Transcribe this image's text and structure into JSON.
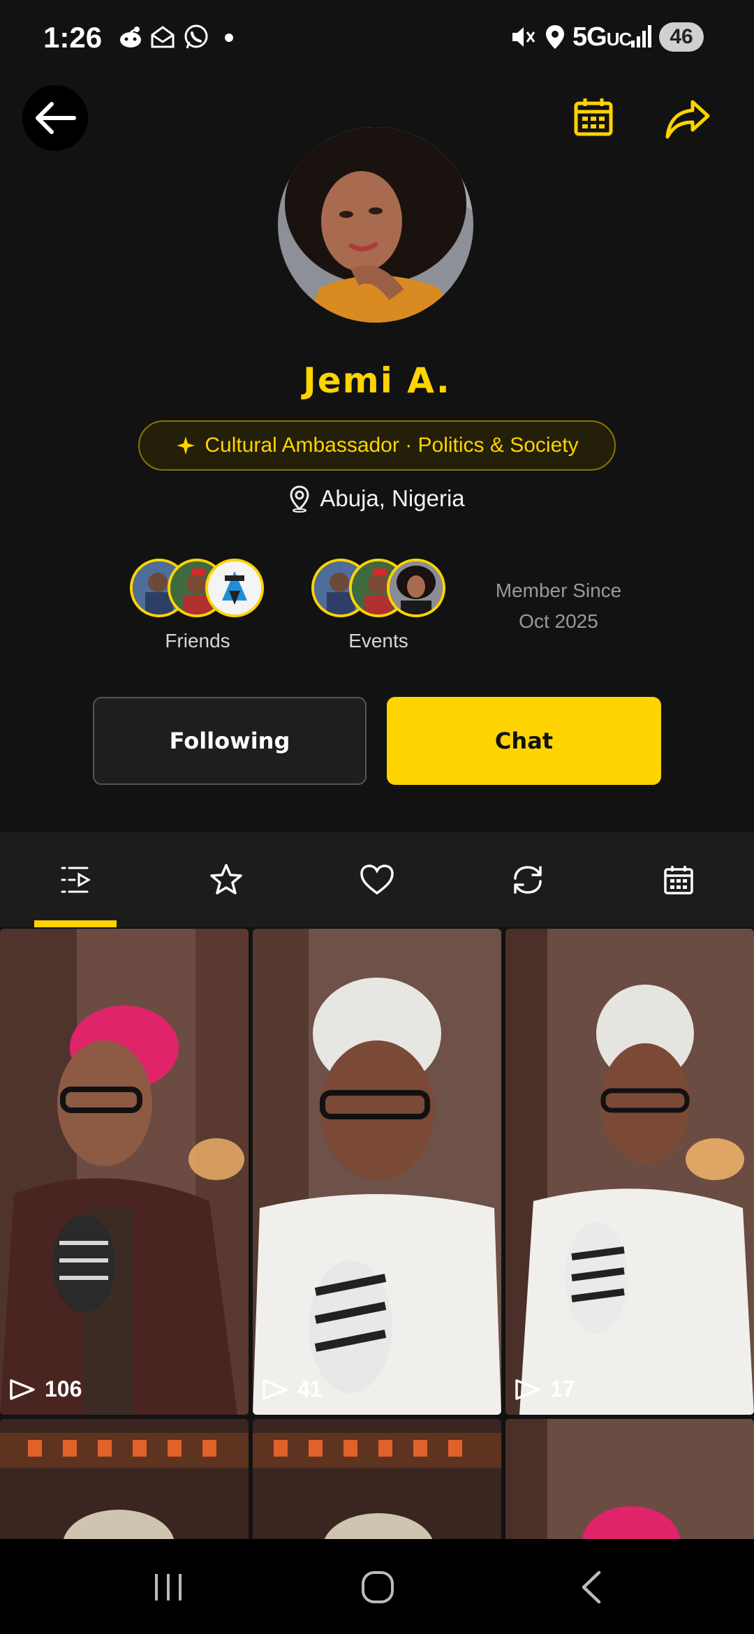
{
  "status_bar": {
    "time": "1:26",
    "network": "5G",
    "network_suffix": "UC",
    "battery": "46",
    "icons": [
      "reddit-icon",
      "mail-icon",
      "whatsapp-icon",
      "dot-icon",
      "mute-icon",
      "location-icon",
      "signal-icon"
    ]
  },
  "header": {
    "back_icon": "arrow-left-icon",
    "calendar_icon": "calendar-icon",
    "share_icon": "share-icon"
  },
  "profile": {
    "name": "Jemi A.",
    "role_icon": "sparkle-icon",
    "role": "Cultural Ambassador · Politics & Society",
    "location_icon": "map-pin-icon",
    "location": "Abuja, Nigeria"
  },
  "stats": {
    "friends_label": "Friends",
    "events_label": "Events",
    "member_since_label": "Member Since",
    "member_since_date": "Oct 2025"
  },
  "actions": {
    "following_label": "Following",
    "chat_label": "Chat"
  },
  "tabs": [
    {
      "icon": "playlist-icon",
      "active": true
    },
    {
      "icon": "star-icon",
      "active": false
    },
    {
      "icon": "heart-icon",
      "active": false
    },
    {
      "icon": "repost-icon",
      "active": false
    },
    {
      "icon": "calendar-icon",
      "active": false
    }
  ],
  "videos": [
    {
      "plays": "106"
    },
    {
      "plays": "41"
    },
    {
      "plays": "17"
    }
  ],
  "colors": {
    "accent": "#FFD400",
    "background": "#121212",
    "tab_bar": "#1c1c1c"
  }
}
